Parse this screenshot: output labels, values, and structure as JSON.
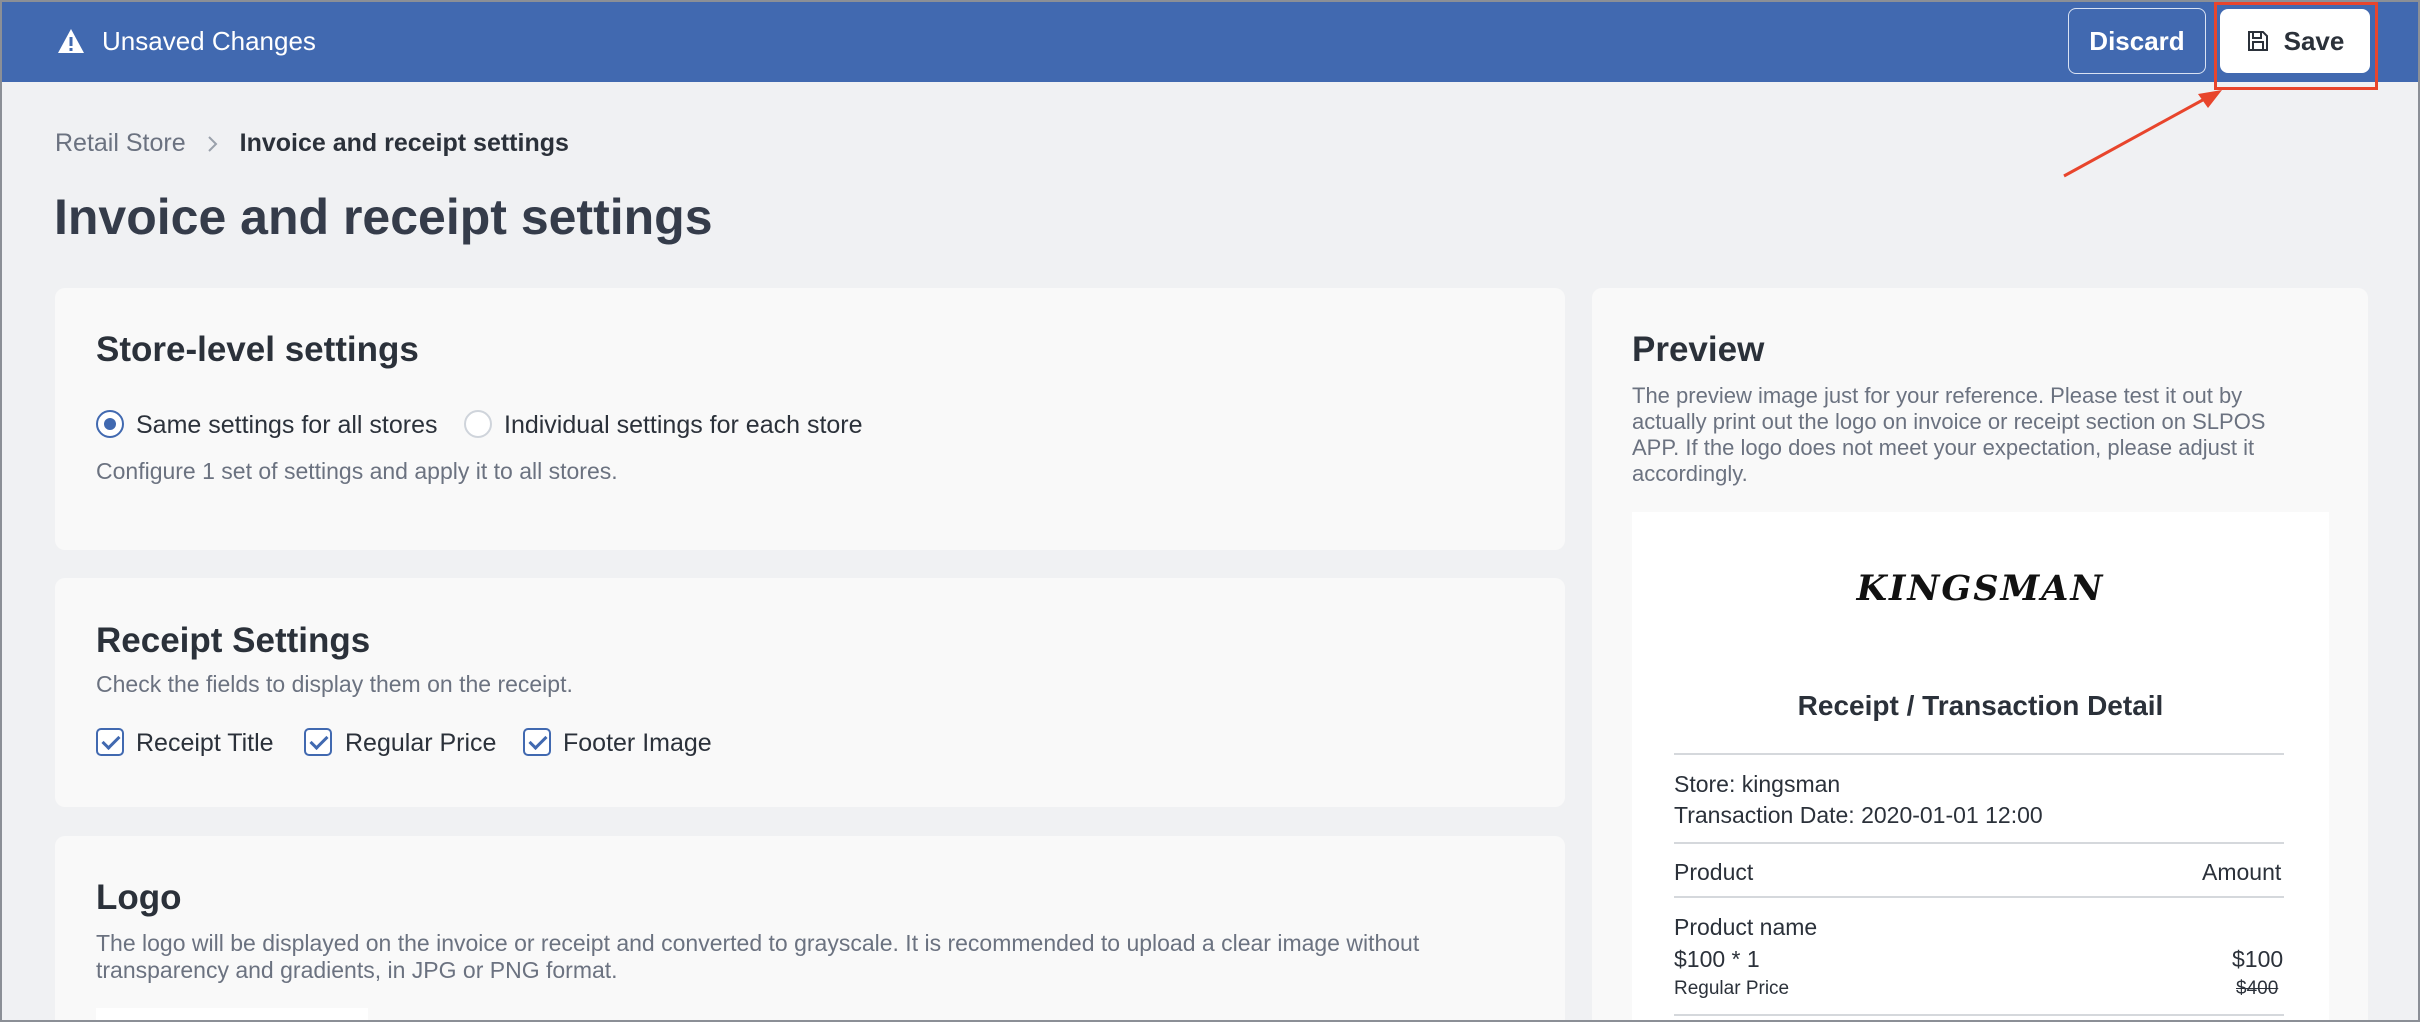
{
  "topbar": {
    "title": "Unsaved Changes",
    "discard_label": "Discard",
    "save_label": "Save"
  },
  "breadcrumb": {
    "parent": "Retail Store",
    "separator": ">",
    "current": "Invoice and receipt settings"
  },
  "page_title": "Invoice and receipt settings",
  "store_settings": {
    "heading": "Store-level settings",
    "options": [
      {
        "label": "Same settings for all stores",
        "checked": true
      },
      {
        "label": "Individual settings for each store",
        "checked": false
      }
    ],
    "description": "Configure 1 set of settings and apply it to all stores."
  },
  "receipt_settings": {
    "heading": "Receipt Settings",
    "description": "Check the fields to display them on the receipt.",
    "fields": [
      {
        "label": "Receipt Title",
        "checked": true
      },
      {
        "label": "Regular Price",
        "checked": true
      },
      {
        "label": "Footer Image",
        "checked": true
      }
    ]
  },
  "logo": {
    "heading": "Logo",
    "description_line1": "The logo will be displayed on the invoice or receipt and converted to grayscale. It is recommended to upload a clear image without",
    "description_line2": "transparency and gradients, in JPG or PNG format."
  },
  "preview": {
    "heading": "Preview",
    "description_lines": [
      "The preview image just for your reference. Please test it out by",
      "actually print out the logo on invoice or receipt section on SLPOS",
      "APP. If the logo does not meet your expectation, please adjust it",
      "accordingly."
    ],
    "receipt": {
      "brand": "KINGSMAN",
      "title": "Receipt / Transaction Detail",
      "store": "Store: kingsman",
      "transaction_date": "Transaction Date: 2020-01-01 12:00",
      "col_product": "Product",
      "col_amount": "Amount",
      "item_name": "Product name",
      "item_qty": "$100 * 1",
      "item_amount": "$100",
      "regular_price_label": "Regular Price",
      "regular_price_value": "$400"
    }
  },
  "colors": {
    "topbar": "#4169b0",
    "accent": "#4169b0",
    "highlight": "#e8452c"
  }
}
